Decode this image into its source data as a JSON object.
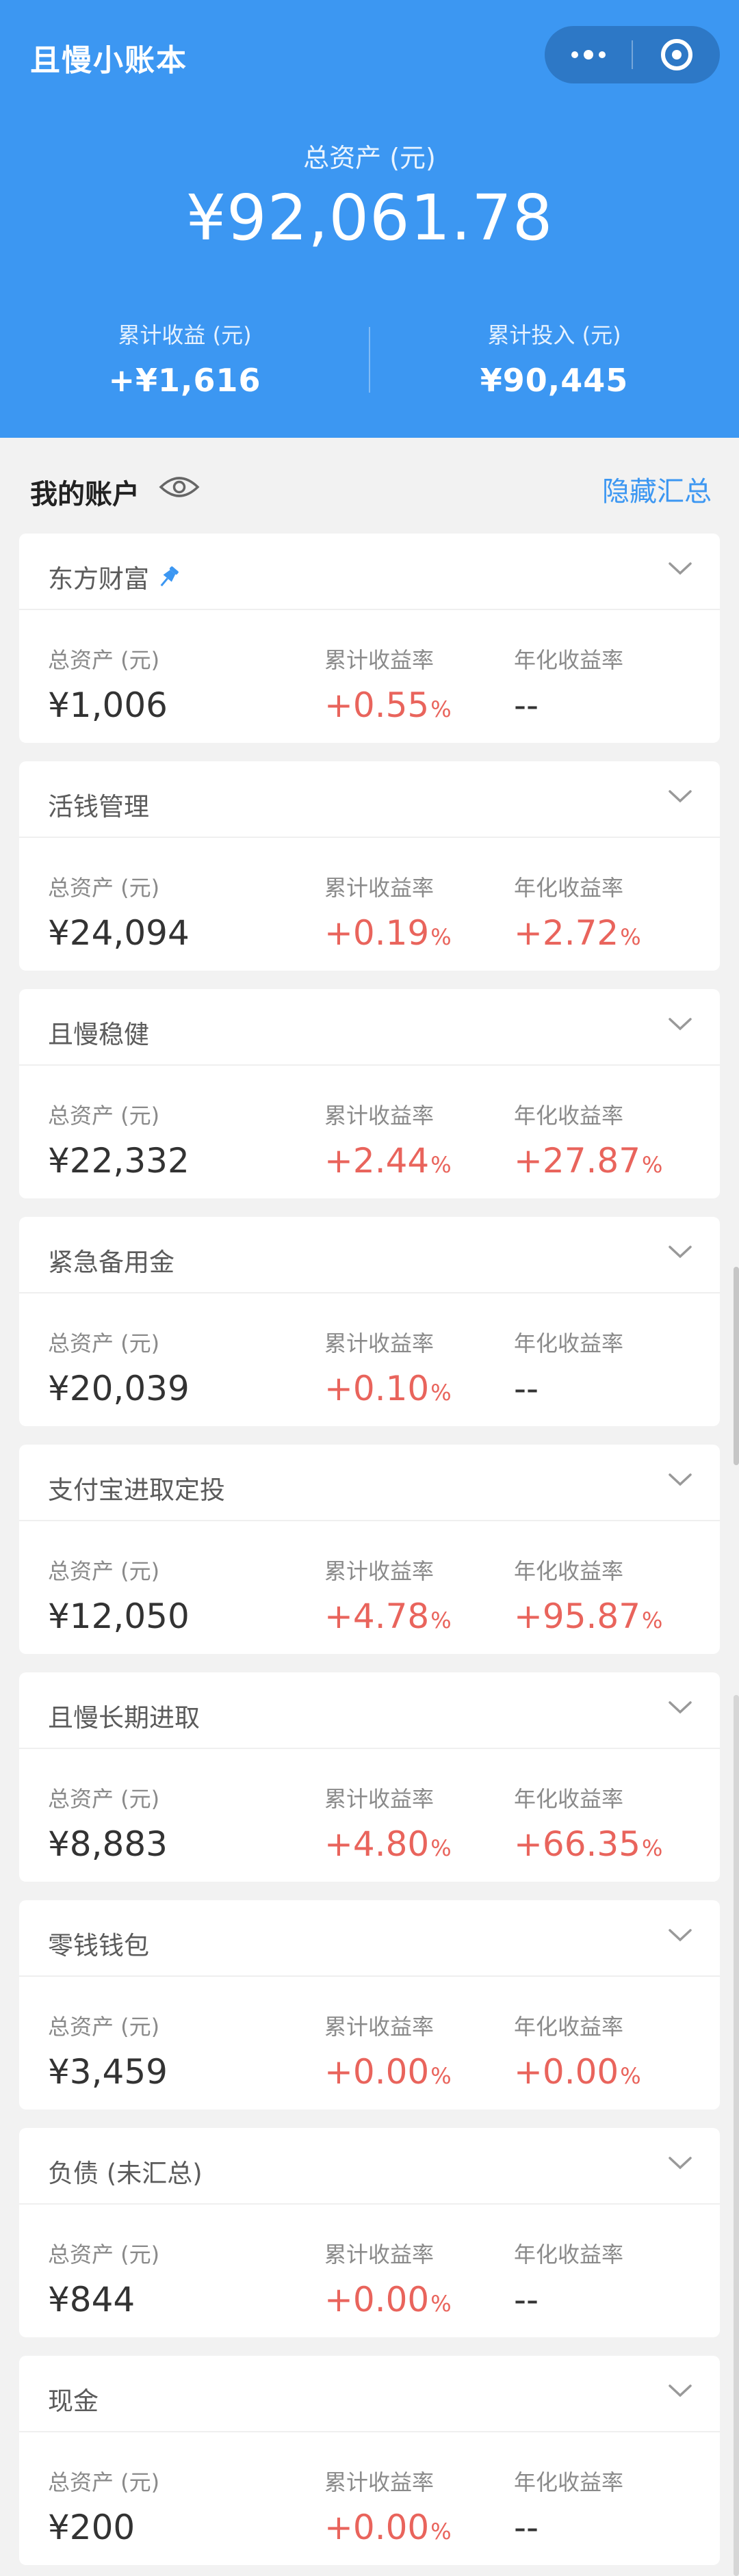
{
  "app": {
    "title": "且慢小账本"
  },
  "summary": {
    "total_label": "总资产 (元)",
    "total_value": "¥92,061.78",
    "profit_label": "累计收益 (元)",
    "profit_value": "+¥1,616",
    "invest_label": "累计投入 (元)",
    "invest_value": "¥90,445"
  },
  "section": {
    "title": "我的账户",
    "hide_summary": "隐藏汇总"
  },
  "labels": {
    "asset": "总资产 (元)",
    "cum_rate": "累计收益率",
    "annual_rate": "年化收益率",
    "percent": "%"
  },
  "colors": {
    "header_bg": "#3c97f2",
    "accent": "#3c97f2",
    "positive": "#e9645c"
  },
  "accounts": [
    {
      "name": "东方财富",
      "pinned": true,
      "asset": "¥1,006",
      "cum": "+0.55",
      "annual": "--"
    },
    {
      "name": "活钱管理",
      "pinned": false,
      "asset": "¥24,094",
      "cum": "+0.19",
      "annual": "+2.72"
    },
    {
      "name": "且慢稳健",
      "pinned": false,
      "asset": "¥22,332",
      "cum": "+2.44",
      "annual": "+27.87"
    },
    {
      "name": "紧急备用金",
      "pinned": false,
      "asset": "¥20,039",
      "cum": "+0.10",
      "annual": "--"
    },
    {
      "name": "支付宝进取定投",
      "pinned": false,
      "asset": "¥12,050",
      "cum": "+4.78",
      "annual": "+95.87"
    },
    {
      "name": "且慢长期进取",
      "pinned": false,
      "asset": "¥8,883",
      "cum": "+4.80",
      "annual": "+66.35"
    },
    {
      "name": "零钱钱包",
      "pinned": false,
      "asset": "¥3,459",
      "cum": "+0.00",
      "annual": "+0.00"
    },
    {
      "name": "负债 (未汇总)",
      "pinned": false,
      "asset": "¥844",
      "cum": "+0.00",
      "annual": "--"
    },
    {
      "name": "现金",
      "pinned": false,
      "asset": "¥200",
      "cum": "+0.00",
      "annual": "--"
    }
  ]
}
